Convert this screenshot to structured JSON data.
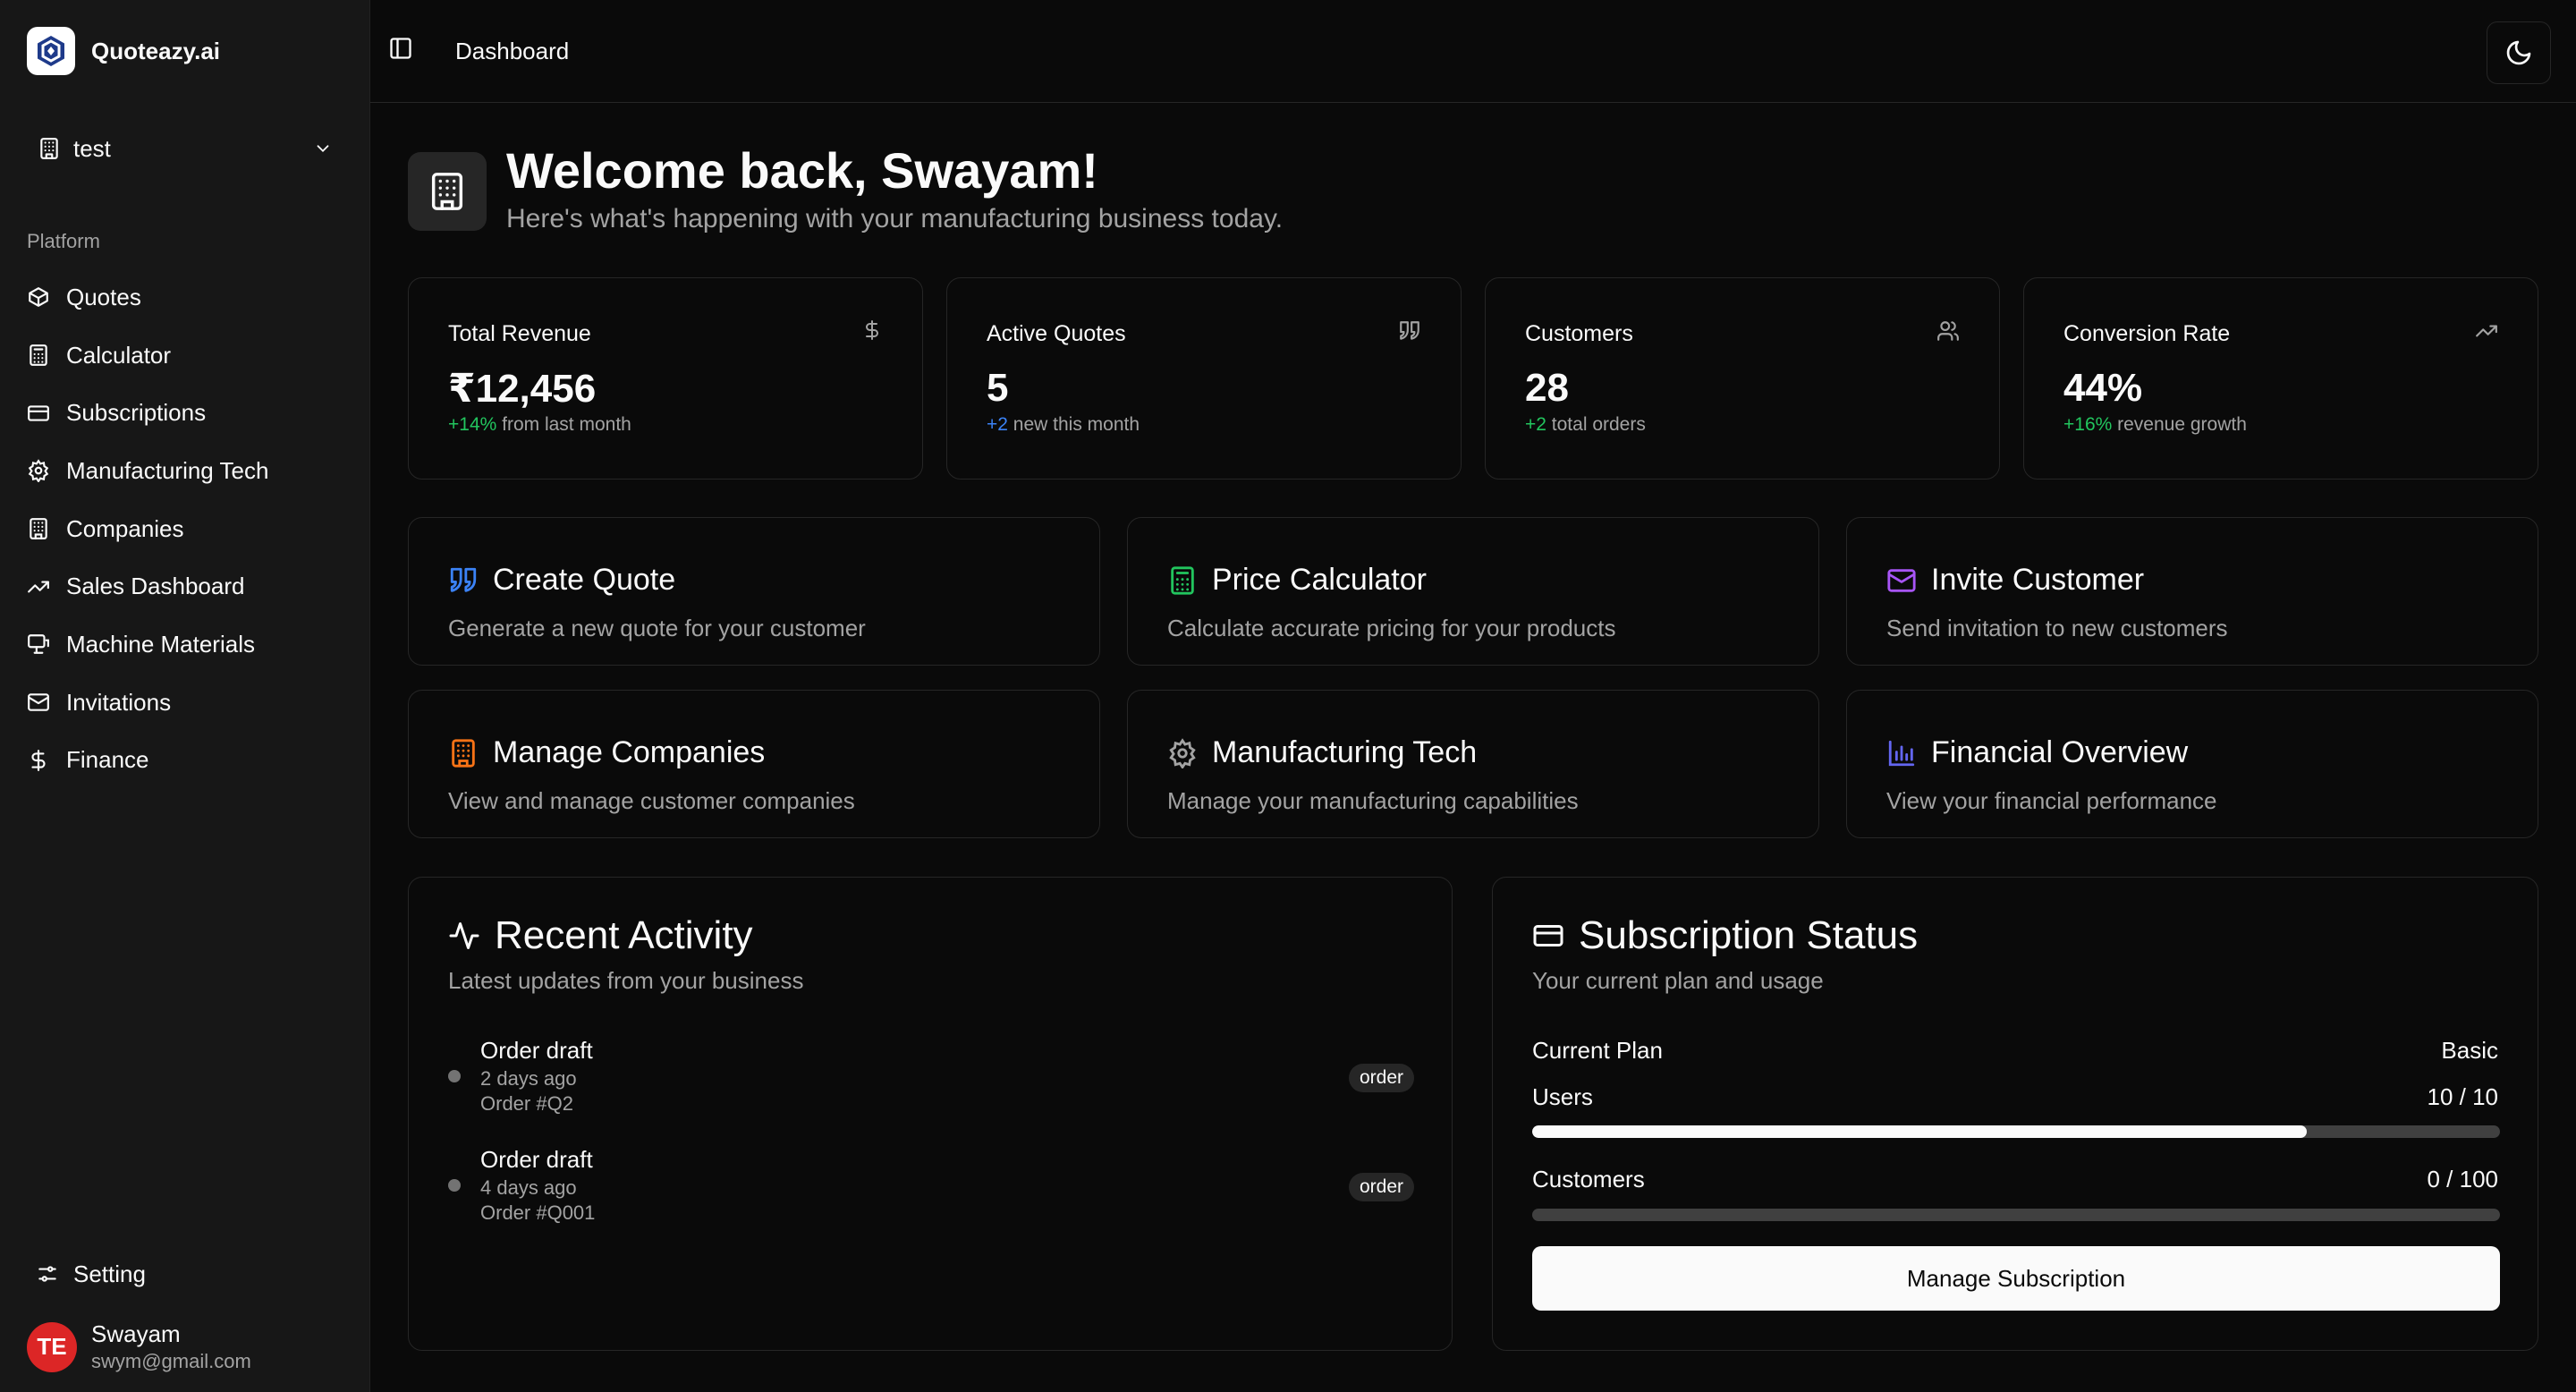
{
  "brand": {
    "name": "Quoteazy.ai"
  },
  "team": {
    "name": "test"
  },
  "sidebar": {
    "section_label": "Platform",
    "items": [
      {
        "label": "Quotes",
        "icon": "box-icon"
      },
      {
        "label": "Calculator",
        "icon": "calculator-icon"
      },
      {
        "label": "Subscriptions",
        "icon": "credit-card-icon"
      },
      {
        "label": "Manufacturing Tech",
        "icon": "gear-icon"
      },
      {
        "label": "Companies",
        "icon": "building-icon"
      },
      {
        "label": "Sales Dashboard",
        "icon": "trending-up-icon"
      },
      {
        "label": "Machine Materials",
        "icon": "monitor-icon"
      },
      {
        "label": "Invitations",
        "icon": "mail-icon"
      },
      {
        "label": "Finance",
        "icon": "dollar-icon"
      }
    ],
    "setting_label": "Setting",
    "user": {
      "initials": "TE",
      "name": "Swayam",
      "email": "swym@gmail.com"
    }
  },
  "header": {
    "title": "Dashboard"
  },
  "welcome": {
    "title": "Welcome back, Swayam!",
    "subtitle": "Here's what's happening with your manufacturing business today."
  },
  "stats": [
    {
      "title": "Total Revenue",
      "value": "₹12,456",
      "delta": "+14%",
      "note": " from last month",
      "delta_color": "#22c55e"
    },
    {
      "title": "Active Quotes",
      "value": "5",
      "delta": "+2",
      "note": " new this month",
      "delta_color": "#3b82f6"
    },
    {
      "title": "Customers",
      "value": "28",
      "delta": "+2",
      "note": " total orders",
      "delta_color": "#22c55e"
    },
    {
      "title": "Conversion Rate",
      "value": "44%",
      "delta": "+16%",
      "note": " revenue growth",
      "delta_color": "#22c55e"
    }
  ],
  "actions": [
    {
      "title": "Create Quote",
      "desc": "Generate a new quote for your customer",
      "color": "#3b82f6"
    },
    {
      "title": "Price Calculator",
      "desc": "Calculate accurate pricing for your products",
      "color": "#22c55e"
    },
    {
      "title": "Invite Customer",
      "desc": "Send invitation to new customers",
      "color": "#a855f7"
    },
    {
      "title": "Manage Companies",
      "desc": "View and manage customer companies",
      "color": "#f97316"
    },
    {
      "title": "Manufacturing Tech",
      "desc": "Manage your manufacturing capabilities",
      "color": "#a3a3a3"
    },
    {
      "title": "Financial Overview",
      "desc": "View your financial performance",
      "color": "#6366f1"
    }
  ],
  "activity": {
    "title": "Recent Activity",
    "subtitle": "Latest updates from your business",
    "items": [
      {
        "title": "Order draft",
        "time": "2 days ago",
        "ref": "Order #Q2",
        "badge": "order"
      },
      {
        "title": "Order draft",
        "time": "4 days ago",
        "ref": "Order #Q001",
        "badge": "order"
      }
    ]
  },
  "subscription": {
    "title": "Subscription Status",
    "subtitle": "Your current plan and usage",
    "plan_label": "Current Plan",
    "plan_value": "Basic",
    "users_label": "Users",
    "users_value": "10 / 10",
    "users_fill": 0.8,
    "customers_label": "Customers",
    "customers_value": "0 / 100",
    "customers_fill": 0,
    "button_label": "Manage Subscription"
  }
}
